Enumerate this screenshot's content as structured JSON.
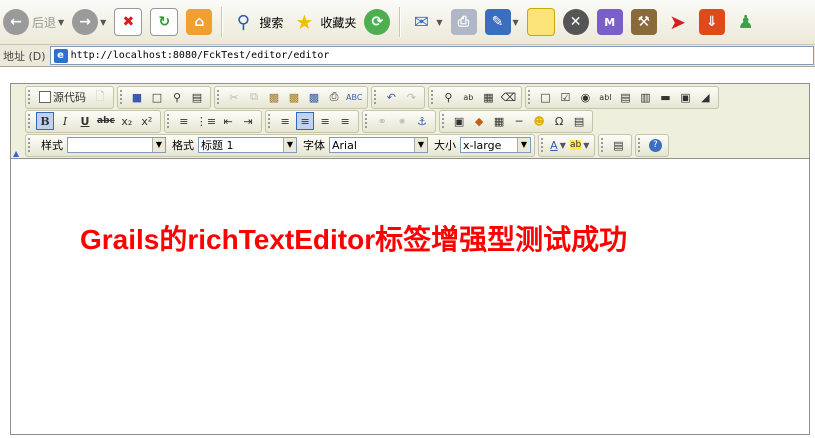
{
  "browser": {
    "toolbar": {
      "back_label": "后退",
      "search_label": "搜索",
      "favorites_label": "收藏夹"
    },
    "address": {
      "label": "地址 (D)",
      "url": "http://localhost:8080/FckTest/editor/editor"
    }
  },
  "editor": {
    "toolbar": {
      "source_label": "源代码",
      "style_label": "样式",
      "style_value": "",
      "format_label": "格式",
      "format_value": "标题 1",
      "font_label": "字体",
      "font_value": "Arial",
      "size_label": "大小",
      "size_value": "x-large",
      "bold_glyph": "B",
      "italic_glyph": "I",
      "underline_glyph": "U",
      "strike_glyph": "abc"
    },
    "content": {
      "heading": "Grails的richTextEditor标签增强型测试成功",
      "heading_color": "#ff0000"
    }
  }
}
